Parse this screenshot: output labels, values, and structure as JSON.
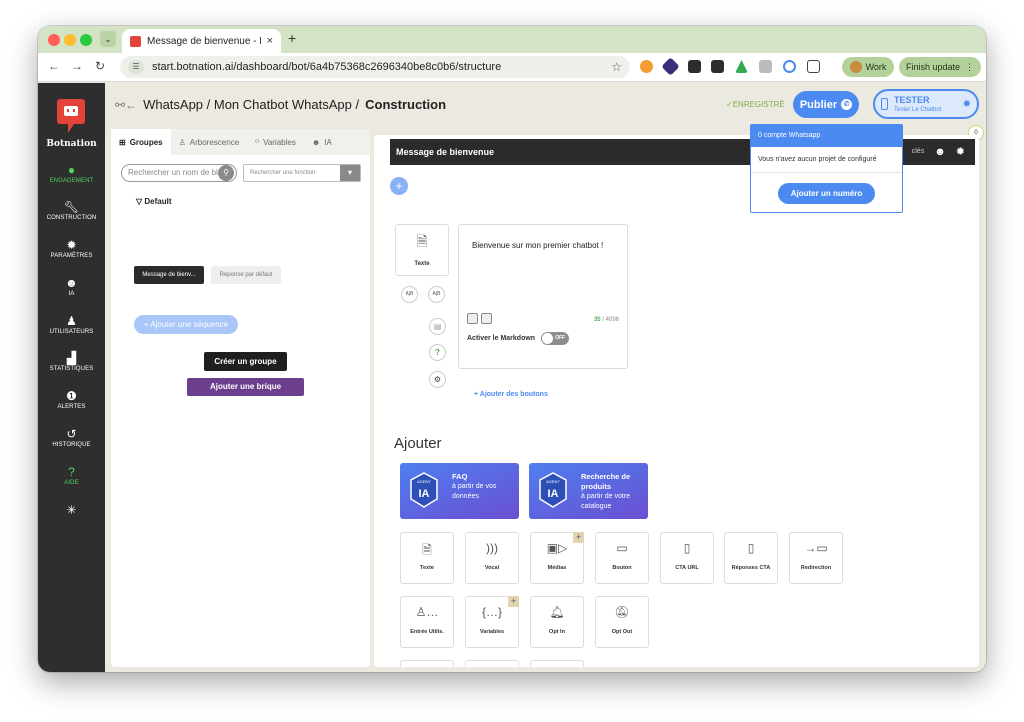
{
  "browser": {
    "tab_title": "Message de bienvenue - Mon",
    "tab_close": "×",
    "new_tab": "+",
    "url": "start.botnation.ai/dashboard/bot/6a4b75368c2696340be8c0b6/structure",
    "profile_label": "Work",
    "update_label": "Finish update"
  },
  "sidebar": {
    "brand": "Botnation",
    "items": [
      {
        "label": "ENGAGEMENT",
        "icon": "whatsapp-icon"
      },
      {
        "label": "CONSTRUCTION",
        "icon": "wrench-icon"
      },
      {
        "label": "PARAMÈTRES",
        "icon": "gear-icon"
      },
      {
        "label": "IA",
        "icon": "robot-icon"
      },
      {
        "label": "UTILISATEURS",
        "icon": "users-icon"
      },
      {
        "label": "STATISTIQUES",
        "icon": "chart-icon"
      },
      {
        "label": "ALERTES",
        "icon": "alert-icon"
      },
      {
        "label": "HISTORIQUE",
        "icon": "history-icon"
      },
      {
        "label": "AIDE",
        "icon": "help-icon"
      }
    ]
  },
  "header": {
    "breadcrumb_prefix": "WhatsApp / Mon Chatbot WhatsApp /",
    "breadcrumb_current": "Construction",
    "saved": "ENREGISTRÉ",
    "publish": "Publier",
    "tester_title": "TESTER",
    "tester_sub": "Tester Le Chatbot",
    "notif_count": "0"
  },
  "left": {
    "tabs": [
      "Groupes",
      "Arborescence",
      "Variables",
      "IA"
    ],
    "search_placeholder": "Rechercher un nom de bloc",
    "function_placeholder": "Rechercher une fonction",
    "group_title": "Default",
    "blocks": [
      "Message de bienv...",
      "Réponse par défaut"
    ],
    "add_sequence": "Ajouter une séquence",
    "create_group": "Créer un groupe",
    "add_brick": "Ajouter une brique"
  },
  "editor": {
    "block_title": "Message de bienvenue",
    "toolbar_hint": "clés",
    "text_card_label": "Texte",
    "message": "Bienvenue sur mon premier chatbot !",
    "count_used": "35",
    "count_max": "/ 4096",
    "markdown_label": "Activer le Markdown",
    "markdown_state": "OFF",
    "add_buttons": "Ajouter des boutons",
    "ab_label": "A|B"
  },
  "add_section": {
    "title": "Ajouter",
    "agents": [
      {
        "badge": "IA",
        "badge_top": "AGENT",
        "title": "FAQ",
        "desc": "à partir de vos données"
      },
      {
        "badge": "IA",
        "badge_top": "AGENT",
        "title": "Recherche de produits",
        "desc": "à partir de votre catalogue"
      }
    ],
    "bricks": [
      {
        "label": "Texte",
        "icon": "document-icon"
      },
      {
        "label": "Vocal",
        "icon": "voice-icon"
      },
      {
        "label": "Médias",
        "icon": "media-icon"
      },
      {
        "label": "Bouton",
        "icon": "button-icon"
      },
      {
        "label": "CTA URL",
        "icon": "cta-url-icon"
      },
      {
        "label": "Réponses CTA",
        "icon": "cta-reply-icon"
      },
      {
        "label": "Redirection",
        "icon": "redirect-icon"
      },
      {
        "label": "Entrée Utilis.",
        "icon": "user-input-icon"
      },
      {
        "label": "Variables",
        "icon": "variables-icon"
      },
      {
        "label": "Opt In",
        "icon": "opt-in-icon"
      },
      {
        "label": "Opt Out",
        "icon": "opt-out-icon"
      }
    ]
  },
  "popover": {
    "header": "0 compte Whatsapp",
    "body": "Vous n'avez aucun projet de configuré",
    "button": "Ajouter un numéro"
  }
}
